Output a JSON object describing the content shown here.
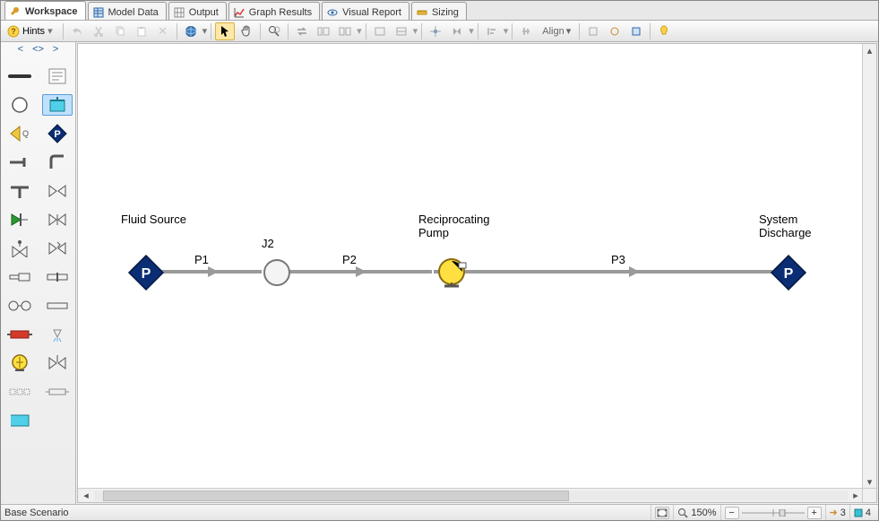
{
  "tabs": {
    "workspace": "Workspace",
    "model_data": "Model Data",
    "output": "Output",
    "graph_results": "Graph Results",
    "visual_report": "Visual Report",
    "sizing": "Sizing"
  },
  "toolbar": {
    "hints": "Hints",
    "align": "Align"
  },
  "palette": {
    "nav_back": "<",
    "nav_mid": "<>",
    "nav_fwd": ">"
  },
  "canvas": {
    "nodes": {
      "fluid_source": "Fluid Source",
      "j2": "J2",
      "recip_pump": "Reciprocating\nPump",
      "system_discharge": "System\nDischarge"
    },
    "pipes": {
      "p1": "P1",
      "p2": "P2",
      "p3": "P3"
    },
    "pressure_letter": "P"
  },
  "status": {
    "scenario": "Base Scenario",
    "zoom": "150%",
    "warn_count": "3",
    "info_count": "4"
  }
}
